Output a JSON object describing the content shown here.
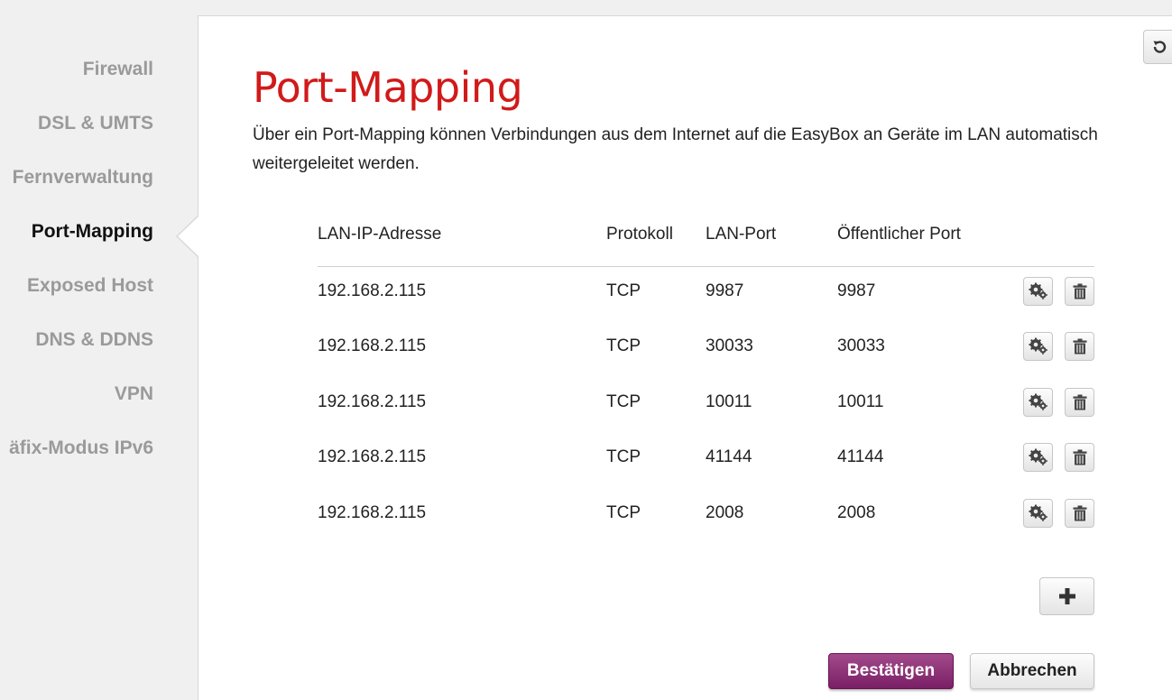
{
  "sidebar": {
    "items": [
      {
        "label": "Firewall",
        "active": false
      },
      {
        "label": "DSL & UMTS",
        "active": false
      },
      {
        "label": "Fernverwaltung",
        "active": false
      },
      {
        "label": "Port-Mapping",
        "active": true
      },
      {
        "label": "Exposed Host",
        "active": false
      },
      {
        "label": "DNS & DDNS",
        "active": false
      },
      {
        "label": "VPN",
        "active": false
      },
      {
        "label": "äfix-Modus IPv6",
        "active": false
      }
    ]
  },
  "main": {
    "title": "Port-Mapping",
    "intro": "Über ein Port-Mapping können Verbindungen aus dem Internet auf die EasyBox an Geräte im LAN automatisch weitergeleitet werden.",
    "table": {
      "headers": [
        "LAN-IP-Adresse",
        "Protokoll",
        "LAN-Port",
        "Öffentlicher Port"
      ],
      "rows": [
        [
          "192.168.2.115",
          "TCP",
          "9987",
          "9987"
        ],
        [
          "192.168.2.115",
          "TCP",
          "30033",
          "30033"
        ],
        [
          "192.168.2.115",
          "TCP",
          "10011",
          "10011"
        ],
        [
          "192.168.2.115",
          "TCP",
          "41144",
          "41144"
        ],
        [
          "192.168.2.115",
          "TCP",
          "2008",
          "2008"
        ]
      ]
    },
    "icons": {
      "row_edit": "gears-icon",
      "row_delete": "trash-icon",
      "add": "plus-icon",
      "reset": "undo-icon"
    },
    "buttons": {
      "confirm": "Bestätigen",
      "cancel": "Abbrechen"
    }
  },
  "colors": {
    "title": "#d11a1a",
    "primary_button": "#8b2c75"
  }
}
